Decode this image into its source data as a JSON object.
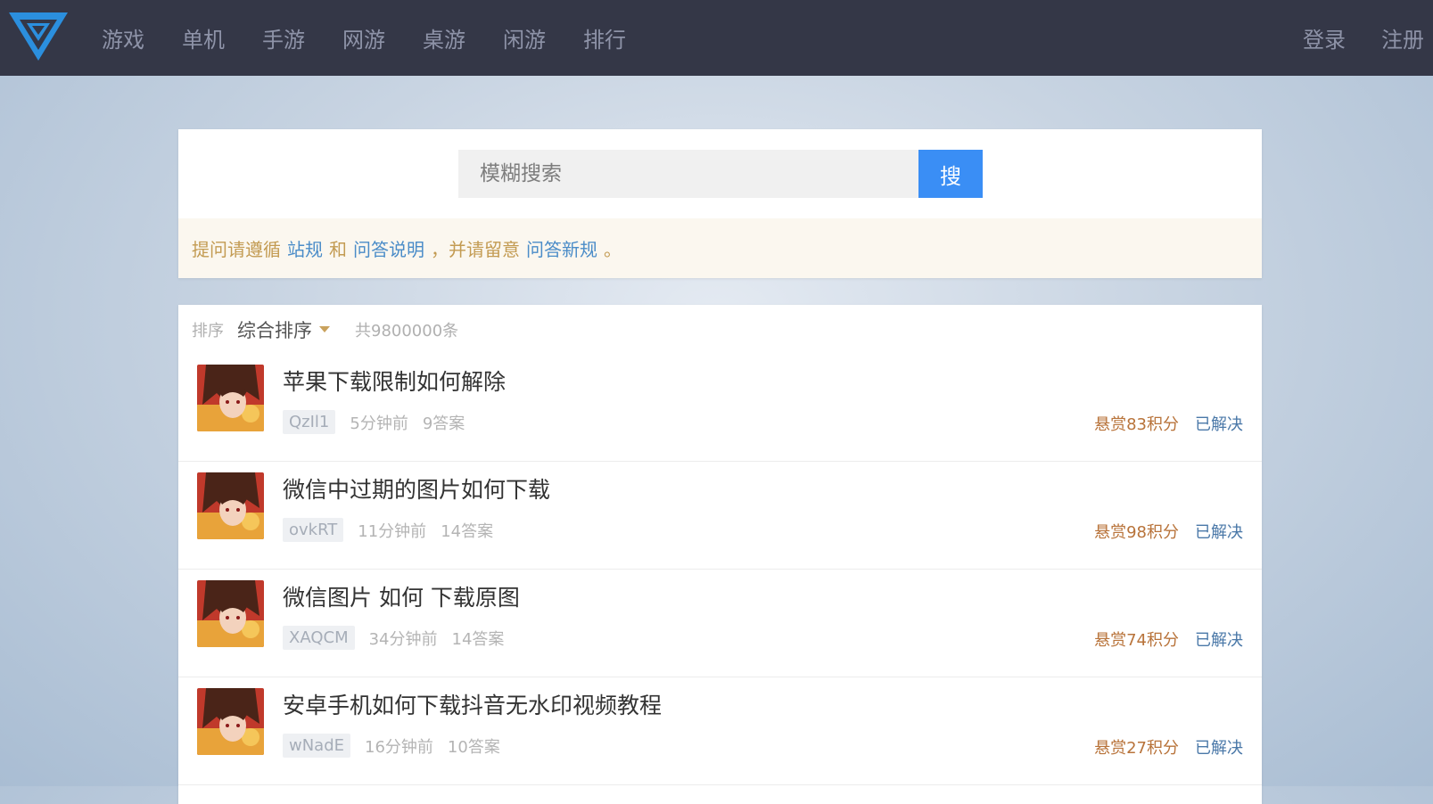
{
  "nav": {
    "logo_icon": "site-logo-v-icon",
    "items": [
      {
        "label": "游戏"
      },
      {
        "label": "单机"
      },
      {
        "label": "手游"
      },
      {
        "label": "网游"
      },
      {
        "label": "桌游"
      },
      {
        "label": "闲游"
      },
      {
        "label": "排行"
      }
    ],
    "login": "登录",
    "register": "注册"
  },
  "search": {
    "placeholder": "模糊搜索",
    "button": "搜"
  },
  "notice": {
    "prefix": "提问请遵循",
    "link1": "站规",
    "and": "和",
    "link2": "问答说明",
    "middle": "，并请留意",
    "link3": "问答新规",
    "suffix": "。"
  },
  "sort": {
    "label": "排序",
    "selected": "综合排序",
    "count": "共9800000条"
  },
  "questions": [
    {
      "title": "苹果下载限制如何解除",
      "user": "QzIl1",
      "time": "5分钟前",
      "answers": "9答案",
      "reward": "悬赏83积分",
      "status": "已解决"
    },
    {
      "title": "微信中过期的图片如何下载",
      "user": "ovkRT",
      "time": "11分钟前",
      "answers": "14答案",
      "reward": "悬赏98积分",
      "status": "已解决"
    },
    {
      "title": "微信图片 如何 下载原图",
      "user": "XAQCM",
      "time": "34分钟前",
      "answers": "14答案",
      "reward": "悬赏74积分",
      "status": "已解决"
    },
    {
      "title": "安卓手机如何下载抖音无水印视频教程",
      "user": "wNadE",
      "time": "16分钟前",
      "answers": "10答案",
      "reward": "悬赏27积分",
      "status": "已解决"
    }
  ],
  "colors": {
    "topbar": "#343747",
    "accent_blue": "#3a8ef5",
    "reward": "#b8733a",
    "status": "#4a78a8"
  }
}
